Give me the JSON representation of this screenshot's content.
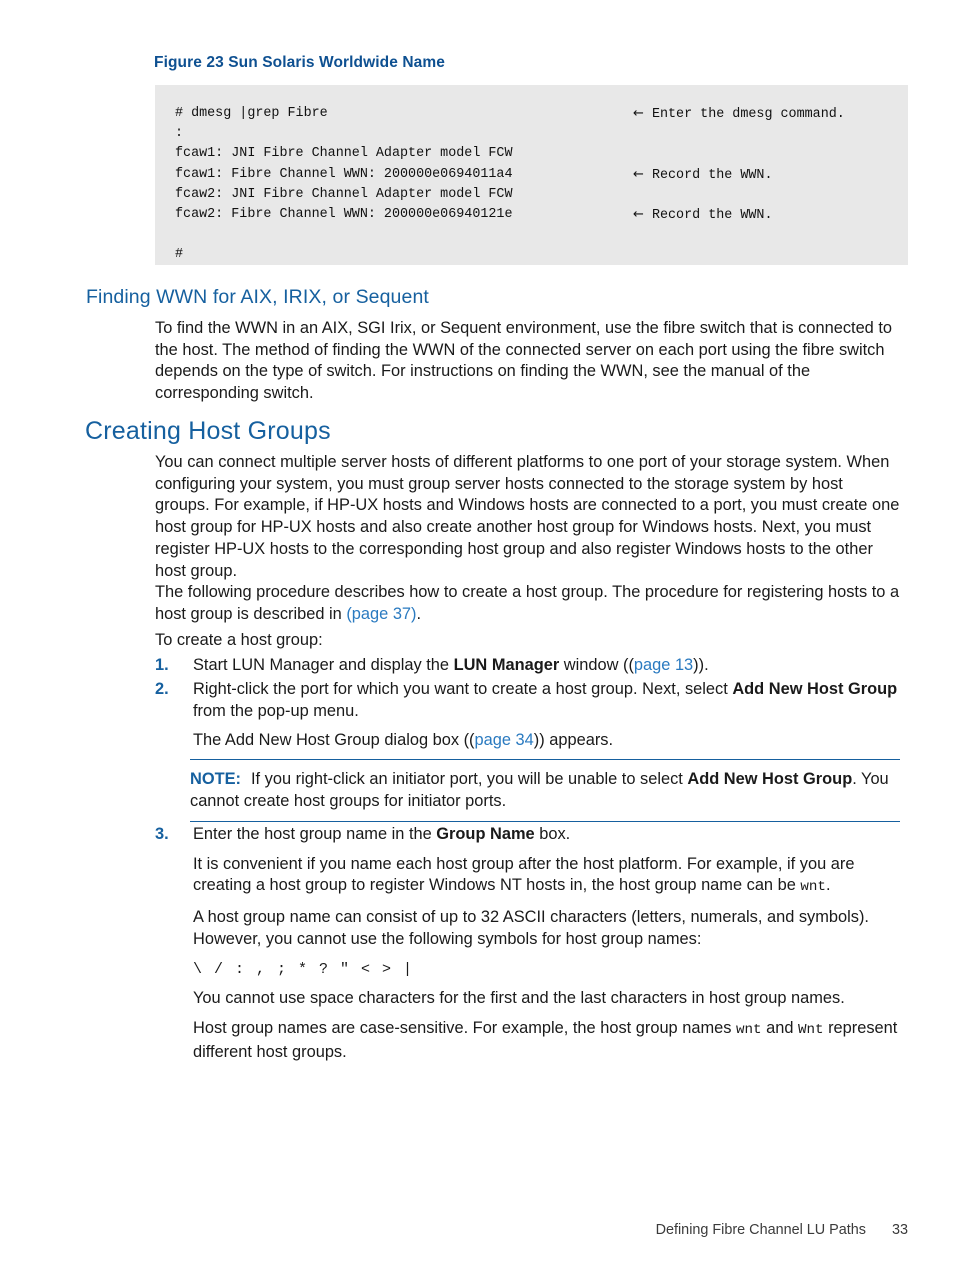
{
  "figure": {
    "caption": "Figure 23 Sun Solaris Worldwide Name",
    "code_lines": [
      "# dmesg |grep Fibre",
      ":",
      "fcaw1: JNI Fibre Channel Adapter model FCW",
      "fcaw1: Fibre Channel WWN: 200000e0694011a4",
      "fcaw2: JNI Fibre Channel Adapter model FCW",
      "fcaw2: Fibre Channel WWN: 200000e06940121e",
      "",
      "#"
    ],
    "annotations": [
      {
        "row": 0,
        "arrow": "←",
        "text": "Enter the dmesg command."
      },
      {
        "row": 3,
        "arrow": "←",
        "text": "Record the WWN."
      },
      {
        "row": 5,
        "arrow": "←",
        "text": "Record the WWN."
      }
    ]
  },
  "sections": {
    "finding_wwn": {
      "heading": "Finding WWN for AIX, IRIX, or Sequent",
      "paragraph": "To find the WWN in an AIX, SGI Irix, or Sequent environment, use the fibre switch that is connected to the host. The method of finding the WWN of the connected server on each port using the fibre switch depends on the type of switch. For instructions on finding the WWN, see the manual of the corresponding switch."
    },
    "creating_host_groups": {
      "heading": "Creating Host Groups",
      "paragraph_1": "You can connect multiple server hosts of different platforms to one port of your storage system. When configuring your system, you must group server hosts connected to the storage system by host groups. For example, if HP-UX hosts and Windows hosts are connected to a port, you must create one host group for HP-UX hosts and also create another host group for Windows hosts. Next, you must register HP-UX hosts to the corresponding host group and also register Windows hosts to the other host group.",
      "paragraph_2_part1": "The following procedure describes how to create a host group. The procedure for registering hosts to a host group is described in ",
      "paragraph_2_link": "(page 37)",
      "paragraph_2_part2": ".",
      "paragraph_3": "To create a host group:"
    }
  },
  "steps": [
    {
      "number": "1.",
      "text_part1": "Start LUN Manager and display the ",
      "bold1": "LUN Manager",
      "text_part2": " window ((",
      "link1": "page 13",
      "text_part3": ")).",
      "sub_paragraphs": []
    },
    {
      "number": "2.",
      "text_part1": "Right-click the port for which you want to create a host group. Next, select ",
      "bold1": "Add New Host Group",
      "text_part2": " from the pop-up menu.",
      "sub_paragraphs": [
        {
          "part1": "The Add New Host Group dialog box ((",
          "link": "page 34",
          "part2": ")) appears."
        }
      ]
    },
    {
      "number": "3.",
      "text_part1": "Enter the host group name in the ",
      "bold1": "Group Name",
      "text_part2": " box.",
      "sub_paragraphs": []
    }
  ],
  "note": {
    "label": "NOTE:",
    "text_part1": "If you right-click an initiator port, you will be unable to select ",
    "bold": "Add New Host Group",
    "text_part2": ". You cannot create host groups for initiator ports."
  },
  "step3_details": {
    "para_1_part1": "It is convenient if you name each host group after the host platform. For example, if you are creating a host group to register Windows NT hosts in, the host group name can be ",
    "para_1_mono": "wnt",
    "para_1_part2": ".",
    "para_2": "A host group name can consist of up to 32 ASCII characters (letters, numerals, and symbols). However, you cannot use the following symbols for host group names:",
    "symbols": "\\ / : , ; * ? \" < > |",
    "para_3": "You cannot use space characters for the first and the last characters in host group names.",
    "para_4_part1": "Host group names are case-sensitive. For example, the host group names ",
    "para_4_mono1": "wnt",
    "para_4_part2": " and ",
    "para_4_mono2": "Wnt",
    "para_4_part3": " represent different host groups."
  },
  "footer": {
    "chapter_title": "Defining Fibre Channel LU Paths",
    "page_number": "33"
  },
  "colors": {
    "heading_blue": "#16609f",
    "caption_blue": "#0e5091",
    "link_blue": "#2a7ac0",
    "code_bg": "#e8e8e8",
    "body_text": "#1a1a1a"
  }
}
